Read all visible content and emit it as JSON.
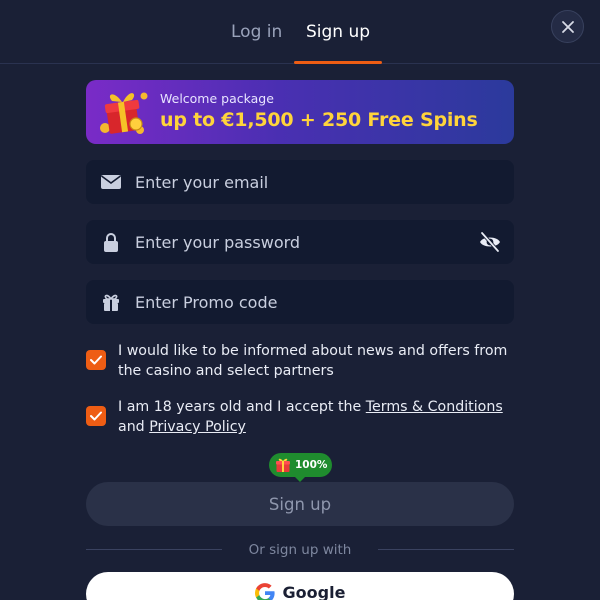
{
  "tabs": [
    {
      "label": "Log in",
      "active": false
    },
    {
      "label": "Sign up",
      "active": true
    }
  ],
  "banner": {
    "subtitle": "Welcome package",
    "title": "up to €1,500 + 250 Free Spins"
  },
  "fields": {
    "email_placeholder": "Enter your email",
    "password_placeholder": "Enter your password",
    "promo_placeholder": "Enter Promo code"
  },
  "consents": {
    "news_text": "I would like to be informed about news and offers from the casino and select partners",
    "age_prefix": "I am 18 years old and I accept the ",
    "terms_link": "Terms & Conditions",
    "age_and": " and ",
    "privacy_link": "Privacy Policy",
    "news_checked": true,
    "age_checked": true
  },
  "bonus_badge": {
    "percent": "100%"
  },
  "signup_button_label": "Sign up",
  "divider_text": "Or sign up with",
  "google_button_label": "Google",
  "colors": {
    "accent": "#ee5d14",
    "background": "#1a2036",
    "field_bg": "#121a30",
    "banner_title": "#ffd43b",
    "badge_green": "#1f8c2e"
  },
  "icons": {
    "close": "close-icon",
    "email": "mail-icon",
    "password": "lock-icon",
    "visibility": "eye-off-icon",
    "promo": "gift-icon",
    "google": "google-logo-icon"
  }
}
